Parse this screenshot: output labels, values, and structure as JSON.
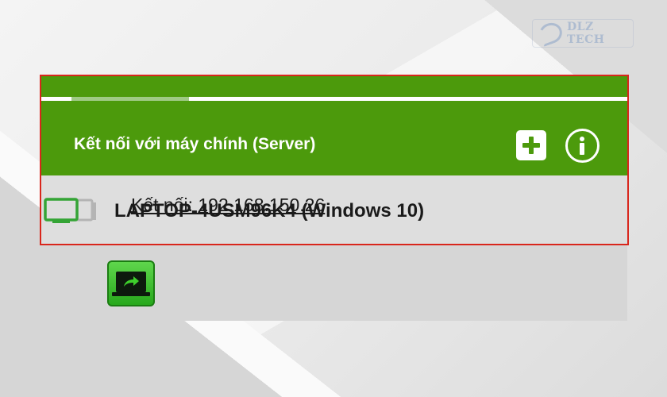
{
  "watermark": {
    "text": "DLZ TECH"
  },
  "header": {
    "title": "Kết nối với máy chính (Server)",
    "add_icon": "plus-icon",
    "info_icon": "info-icon",
    "progress": 0.2,
    "accent_color": "#4c9a0c"
  },
  "server": {
    "name": "LAPTOP-4USM96K4 (Windows 10)",
    "icon": "monitor-icon"
  },
  "connection": {
    "label": "Kết nối: 192.168.150.26",
    "icon": "remote-connect-icon"
  },
  "highlight_color": "#d9261c"
}
